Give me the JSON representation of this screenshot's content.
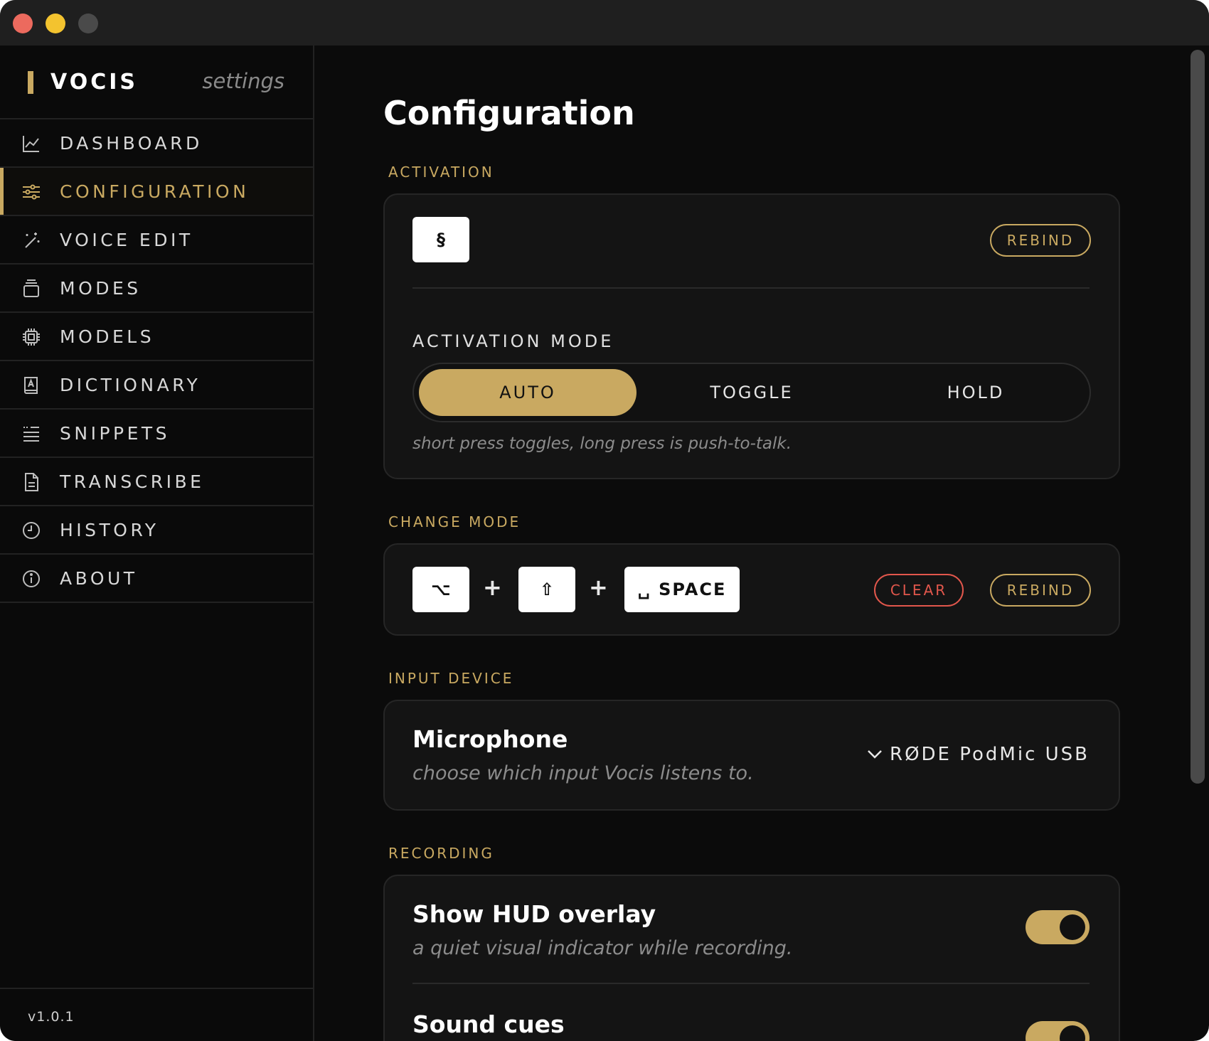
{
  "app": {
    "name": "VOCIS",
    "subtitle": "settings",
    "version": "v1.0.1",
    "accent": "#c9a961",
    "danger": "#e2574c"
  },
  "nav": [
    {
      "label": "DASHBOARD",
      "icon": "chart-line-icon"
    },
    {
      "label": "CONFIGURATION",
      "icon": "sliders-icon",
      "active": true
    },
    {
      "label": "VOICE EDIT",
      "icon": "magic-wand-icon"
    },
    {
      "label": "MODES",
      "icon": "stack-icon"
    },
    {
      "label": "MODELS",
      "icon": "chip-icon"
    },
    {
      "label": "DICTIONARY",
      "icon": "book-icon"
    },
    {
      "label": "SNIPPETS",
      "icon": "quote-list-icon"
    },
    {
      "label": "TRANSCRIBE",
      "icon": "document-icon"
    },
    {
      "label": "HISTORY",
      "icon": "clock-icon"
    },
    {
      "label": "ABOUT",
      "icon": "info-icon"
    }
  ],
  "page": {
    "title": "Configuration"
  },
  "activation": {
    "section_label": "ACTIVATION",
    "key": "§",
    "rebind_label": "REBIND",
    "mode_label": "ACTIVATION MODE",
    "modes": [
      "AUTO",
      "TOGGLE",
      "HOLD"
    ],
    "selected_mode": "AUTO",
    "hint": "short press toggles, long press is push-to-talk."
  },
  "change_mode": {
    "section_label": "CHANGE MODE",
    "keys": [
      "⌥",
      "⇧",
      "␣ SPACE"
    ],
    "plus": "+",
    "clear_label": "CLEAR",
    "rebind_label": "REBIND"
  },
  "input_device": {
    "section_label": "INPUT DEVICE",
    "title": "Microphone",
    "subtitle": "choose which input Vocis listens to.",
    "selected": "RØDE PodMic USB"
  },
  "recording": {
    "section_label": "RECORDING",
    "hud_title": "Show HUD overlay",
    "hud_subtitle": "a quiet visual indicator while recording.",
    "hud_on": true,
    "sound_title": "Sound cues",
    "sound_on": true
  }
}
